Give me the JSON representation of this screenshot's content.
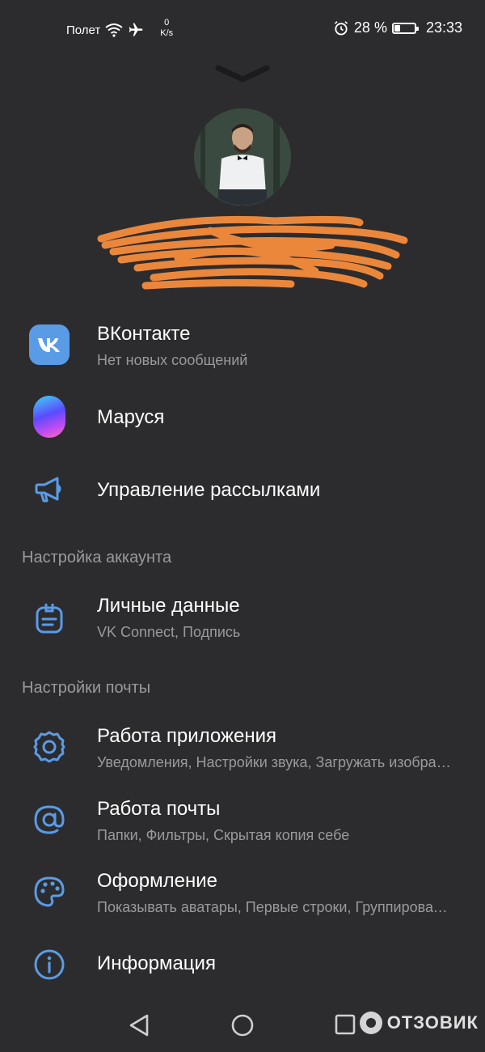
{
  "status_bar": {
    "network_label": "Полет",
    "speed_value": "0",
    "speed_unit": "K/s",
    "battery_percent_text": "28 %",
    "battery_level": 0.28,
    "time": "23:33"
  },
  "menu": {
    "vk": {
      "title": "ВКонтакте",
      "subtitle": "Нет новых сообщений",
      "icon": "vk-logo-icon"
    },
    "marusia": {
      "title": "Маруся",
      "icon": "marusia-icon"
    },
    "newsletters": {
      "title": "Управление рассылками",
      "icon": "megaphone-icon"
    }
  },
  "sections": {
    "account": {
      "header": "Настройка аккаунта",
      "personal": {
        "title": "Личные данные",
        "subtitle": "VK Connect, Подпись",
        "icon": "profile-card-icon"
      }
    },
    "mail": {
      "header": "Настройки почты",
      "app": {
        "title": "Работа приложения",
        "subtitle": "Уведомления, Настройки звука, Загружать изображения",
        "icon": "gear-icon"
      },
      "mail_work": {
        "title": "Работа почты",
        "subtitle": "Папки, Фильтры, Скрытая копия себе",
        "icon": "at-icon"
      },
      "appearance": {
        "title": "Оформление",
        "subtitle": "Показывать аватары, Первые строки, Группировать письма",
        "icon": "palette-icon"
      },
      "info": {
        "title": "Информация",
        "icon": "info-icon"
      }
    }
  },
  "watermark": {
    "text": "ОТЗОВИК"
  },
  "colors": {
    "background": "#2c2c2e",
    "accent": "#5a9be6",
    "secondary_text": "#9a9a9e",
    "redaction": "#f28a3c"
  }
}
